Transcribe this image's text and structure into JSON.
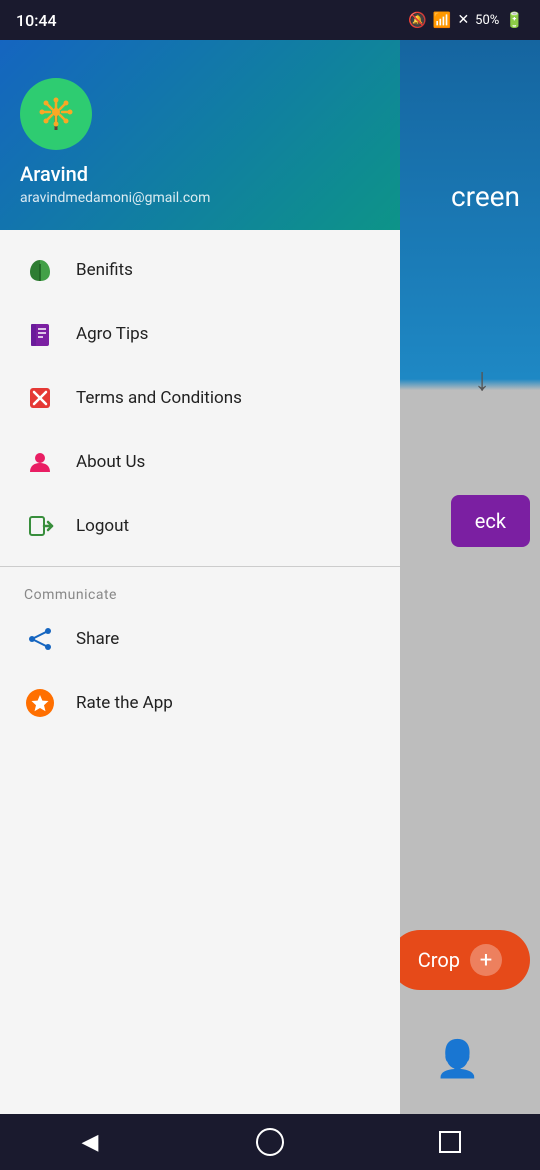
{
  "status_bar": {
    "time": "10:44",
    "battery": "50%"
  },
  "drawer": {
    "user": {
      "name": "Aravind",
      "email": "aravindmedamoni@gmail.com"
    },
    "menu_items": [
      {
        "id": "benefits",
        "label": "Benifits",
        "icon": "leaf-icon",
        "color": "#2e7d32"
      },
      {
        "id": "agro-tips",
        "label": "Agro Tips",
        "icon": "book-icon",
        "color": "#6a1b9a"
      },
      {
        "id": "terms",
        "label": "Terms and Conditions",
        "icon": "cross-icon",
        "color": "#c62828"
      },
      {
        "id": "about-us",
        "label": "About Us",
        "icon": "person-icon",
        "color": "#e91e63"
      },
      {
        "id": "logout",
        "label": "Logout",
        "icon": "logout-icon",
        "color": "#388e3c"
      }
    ],
    "communicate_section": {
      "header": "Communicate",
      "items": [
        {
          "id": "share",
          "label": "Share",
          "icon": "share-icon",
          "color": "#1565c0"
        },
        {
          "id": "rate-app",
          "label": "Rate the App",
          "icon": "star-icon",
          "color": "#ff6f00"
        }
      ]
    }
  },
  "bg": {
    "screen_text": "creen",
    "check_label": "eck",
    "crop_label": "Crop"
  },
  "nav": {
    "back_label": "◀",
    "home_label": "○",
    "recent_label": "□"
  }
}
